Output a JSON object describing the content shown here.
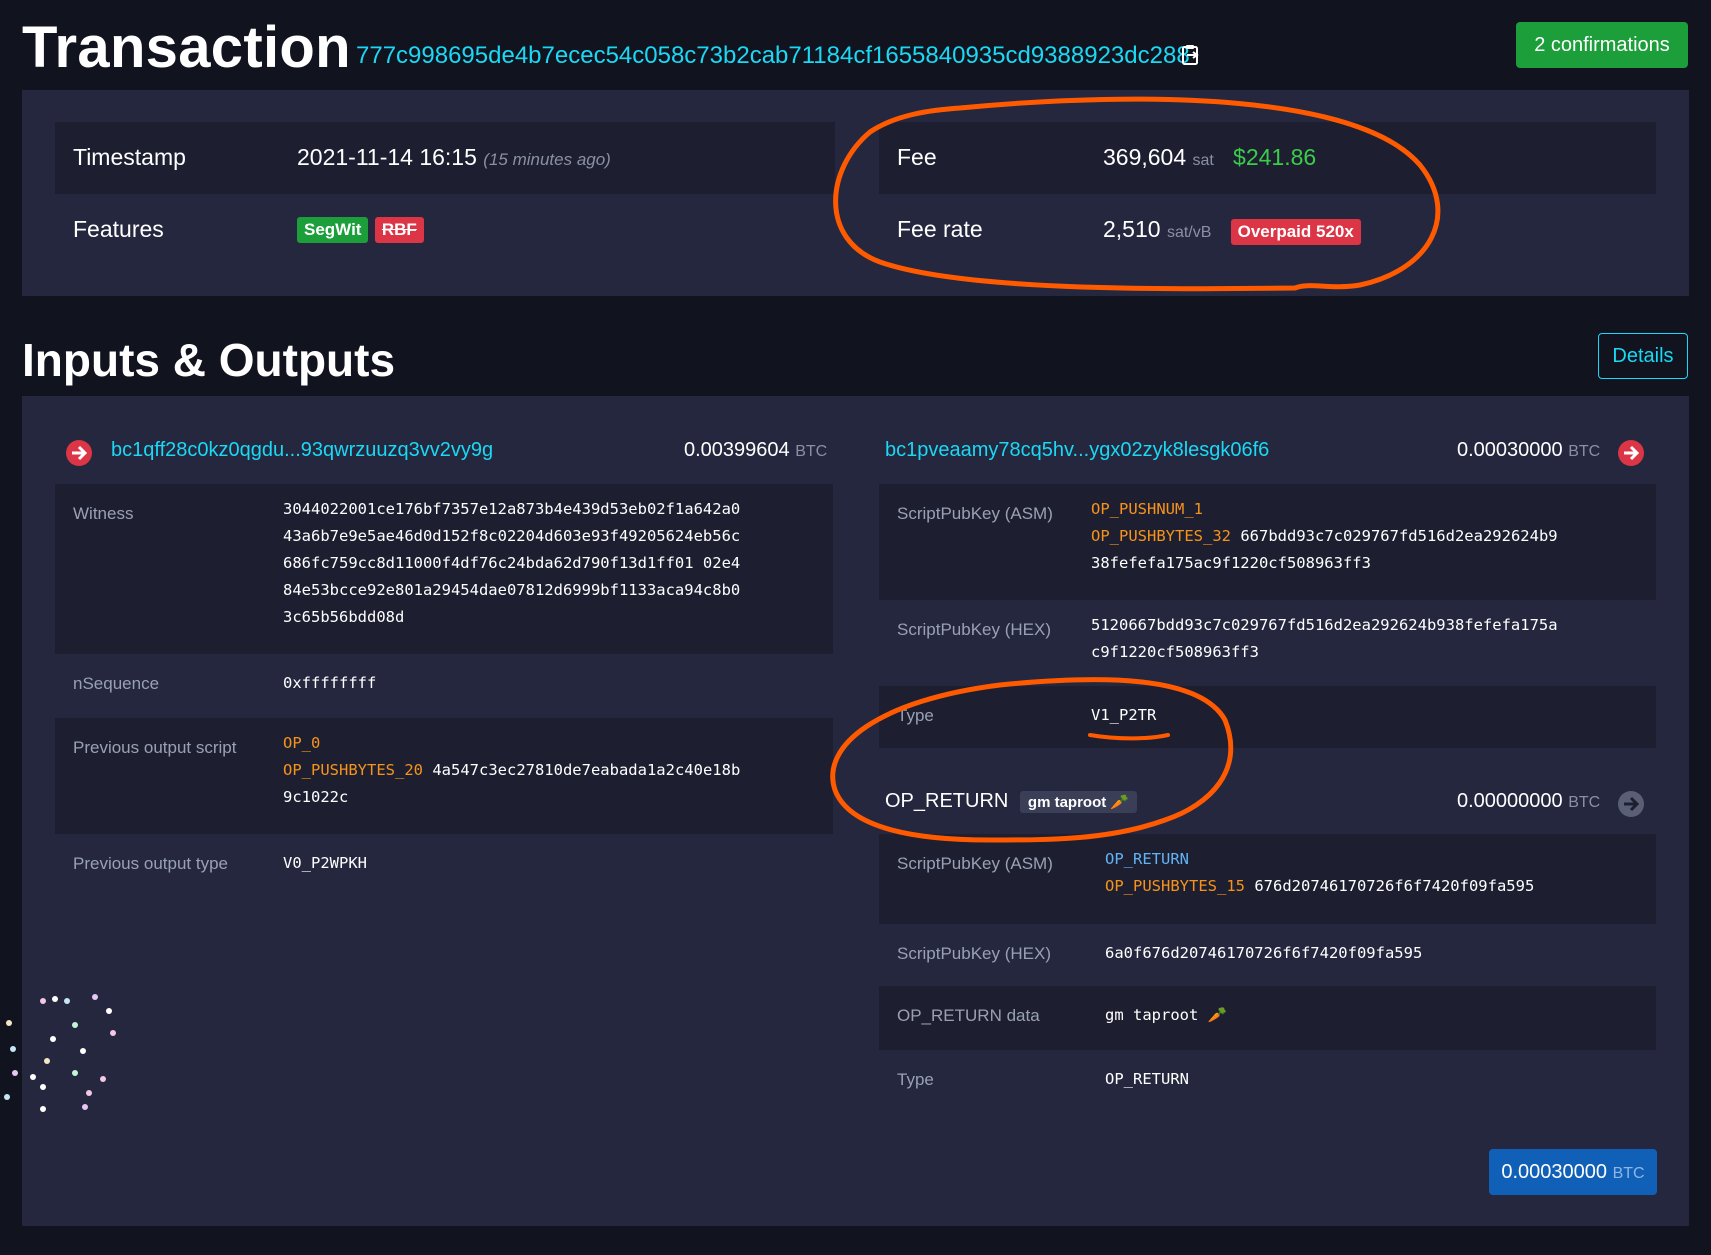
{
  "header": {
    "title": "Transaction",
    "txid": "777c998695de4b7ecec54c058c73b2cab71184cf1655840935cd9388923dc288",
    "confirmations": "2 confirmations"
  },
  "summary": {
    "timestamp_label": "Timestamp",
    "timestamp_value": "2021-11-14 16:15",
    "timestamp_ago": "(15 minutes ago)",
    "features_label": "Features",
    "feature_segwit": "SegWit",
    "feature_rbf": "RBF",
    "fee_label": "Fee",
    "fee_value": "369,604",
    "fee_unit": "sat",
    "fee_usd": "$241.86",
    "feerate_label": "Fee rate",
    "feerate_value": "2,510",
    "feerate_unit": "sat/vB",
    "overpaid_badge": "Overpaid 520x"
  },
  "io": {
    "title": "Inputs & Outputs",
    "details_button": "Details",
    "input": {
      "address": "bc1qff28c0kz0qgdu...93qwrzuuzq3vv2vy9g",
      "amount": "0.00399604",
      "unit": "BTC",
      "witness_label": "Witness",
      "witness_lines": [
        "3044022001ce176bf7357e12a873b4e439d53eb02f1a642a0",
        "43a6b7e9e5ae46d0d152f8c02204d603e93f49205624eb56c",
        "686fc759cc8d11000f4df76c24bda62d790f13d1ff01 02e4",
        "84e53bcce92e801a29454dae07812d6999bf1133aca94c8b0",
        "3c65b56bdd08d"
      ],
      "nsequence_label": "nSequence",
      "nsequence_value": "0xffffffff",
      "prevscript_label": "Previous output script",
      "prevscript_op0": "OP_0",
      "prevscript_push": "OP_PUSHBYTES_20",
      "prevscript_data1": "4a547c3ec27810de7eabada1a2c40e18b",
      "prevscript_data2": "9c1022c",
      "prevtype_label": "Previous output type",
      "prevtype_value": "V0_P2WPKH"
    },
    "output1": {
      "address": "bc1pveaamy78cq5hv...ygx02zyk8lesgk06f6",
      "amount": "0.00030000",
      "unit": "BTC",
      "asm_label": "ScriptPubKey (ASM)",
      "asm_op1": "OP_PUSHNUM_1",
      "asm_op2": "OP_PUSHBYTES_32",
      "asm_data1": "667bdd93c7c029767fd516d2ea292624b9",
      "asm_data2": "38fefefa175ac9f1220cf508963ff3",
      "hex_label": "ScriptPubKey (HEX)",
      "hex_line1": "5120667bdd93c7c029767fd516d2ea292624b938fefefa175a",
      "hex_line2": "c9f1220cf508963ff3",
      "type_label": "Type",
      "type_value": "V1_P2TR"
    },
    "output2": {
      "title": "OP_RETURN",
      "badge": "gm taproot",
      "amount": "0.00000000",
      "unit": "BTC",
      "asm_label": "ScriptPubKey (ASM)",
      "asm_op1": "OP_RETURN",
      "asm_op2": "OP_PUSHBYTES_15",
      "asm_data": "676d20746170726f6f7420f09fa595",
      "hex_label": "ScriptPubKey (HEX)",
      "hex_value": "6a0f676d20746170726f6f7420f09fa595",
      "data_label": "OP_RETURN data",
      "data_value": "gm taproot",
      "type_label": "Type",
      "type_value": "OP_RETURN"
    },
    "total_amount": "0.00030000",
    "total_unit": "BTC"
  },
  "icons": {
    "copy": "copy-icon",
    "input_arrow": "arrow-right-circle-icon",
    "output_arrow": "arrow-right-circle-icon",
    "carrot": "carrot-emoji"
  },
  "colors": {
    "background": "#11131f",
    "panel": "#24273e",
    "link": "#1bd8f4",
    "confirm_green": "#1c9e3a",
    "usd_green": "#3bcc49",
    "overpaid_red": "#dc3545",
    "opcode_orange": "#f7931a",
    "annotation_orange": "#ff5a00",
    "total_blue": "#1060b8"
  }
}
